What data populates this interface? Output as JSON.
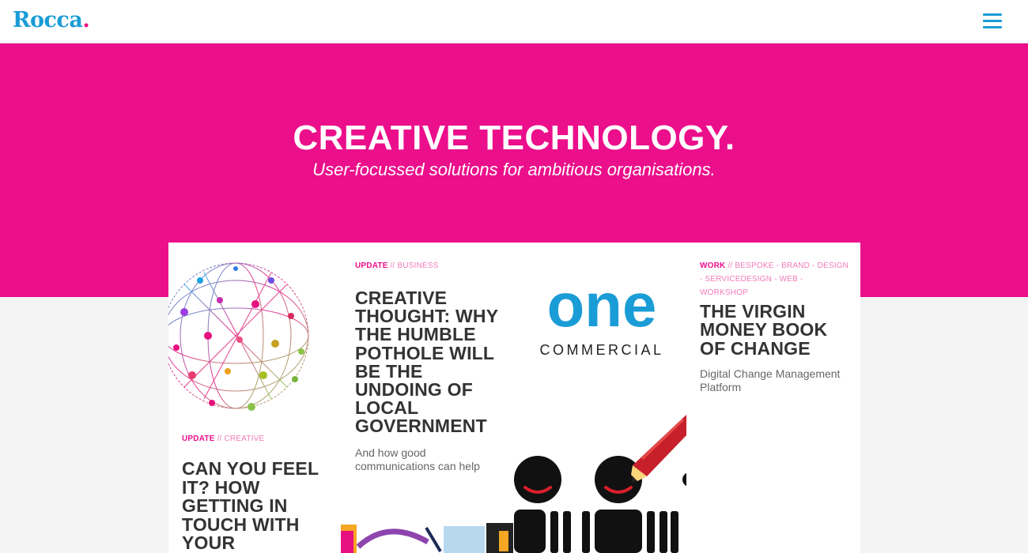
{
  "header": {
    "logo_text": "Rocca",
    "logo_dot": ".",
    "menu_icon": "hamburger-menu-icon"
  },
  "hero": {
    "title": "CREATIVE TECHNOLOGY.",
    "subtitle": "User-focussed solutions for ambitious organisations."
  },
  "cards": [
    {
      "tag_type": "UPDATE",
      "tag_categories": "// CREATIVE",
      "title": "CAN YOU FEEL IT? HOW GETTING IN TOUCH WITH YOUR",
      "image": "globe-network-illustration"
    },
    {
      "tag_type": "UPDATE",
      "tag_categories": "// BUSINESS",
      "title": "CREATIVE THOUGHT: WHY THE HUMBLE POTHOLE WILL BE THE UNDOING OF LOCAL GOVERNMENT",
      "description": "And how good communications can help"
    },
    {
      "tag_type": "WORK",
      "tag_categories": "// BESPOKE - BRAND - DESIGN - SERVICEDESIGN - WEB - WORKSHOP",
      "title": "THE VIRGIN MONEY BOOK OF CHANGE",
      "description": "Digital Change Management Platform"
    }
  ],
  "one_commercial": {
    "word": "one",
    "sub": "COMMERCIAL"
  },
  "colors": {
    "brand_blue": "#1a9cd6",
    "brand_pink": "#eb0f8b",
    "text_dark": "#333333"
  }
}
